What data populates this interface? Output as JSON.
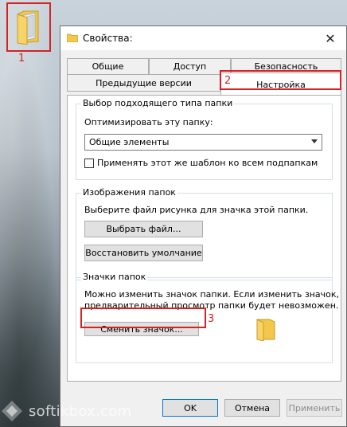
{
  "desktop": {
    "callout_1": "1",
    "folder_icon": "folder-icon"
  },
  "window": {
    "title": "Свойства:",
    "close_glyph": "✕"
  },
  "tabs": {
    "row1": [
      "Общие",
      "Доступ",
      "Безопасность"
    ],
    "row2": [
      "Предыдущие версии",
      "Настройка"
    ],
    "active": "Настройка",
    "callout_2": "2"
  },
  "folder_type": {
    "group_label": "Выбор подходящего типа папки",
    "optimize_label": "Оптимизировать эту папку:",
    "selected_value": "Общие элементы",
    "apply_checkbox_label": "Применять этот же шаблон ко всем подпапкам"
  },
  "folder_images": {
    "group_label": "Изображения папок",
    "hint": "Выберите файл рисунка для значка этой папки.",
    "choose_file_button": "Выбрать файл...",
    "restore_default_button": "Восстановить умолчание"
  },
  "folder_icons": {
    "group_label": "Значки папок",
    "description_line1": "Можно изменить значок папки. Если изменить значок,",
    "description_line2": "предварительный просмотр папки будет невозможен.",
    "change_icon_button": "Сменить значок...",
    "callout_3": "3"
  },
  "footer": {
    "ok": "OK",
    "cancel": "Отмена",
    "apply": "Применить"
  },
  "watermark": {
    "text": "softikbox.com"
  },
  "colors": {
    "callout_red": "#d32424",
    "folder_yellow": "#f3c74a",
    "window_bg": "#f0f0f0"
  }
}
